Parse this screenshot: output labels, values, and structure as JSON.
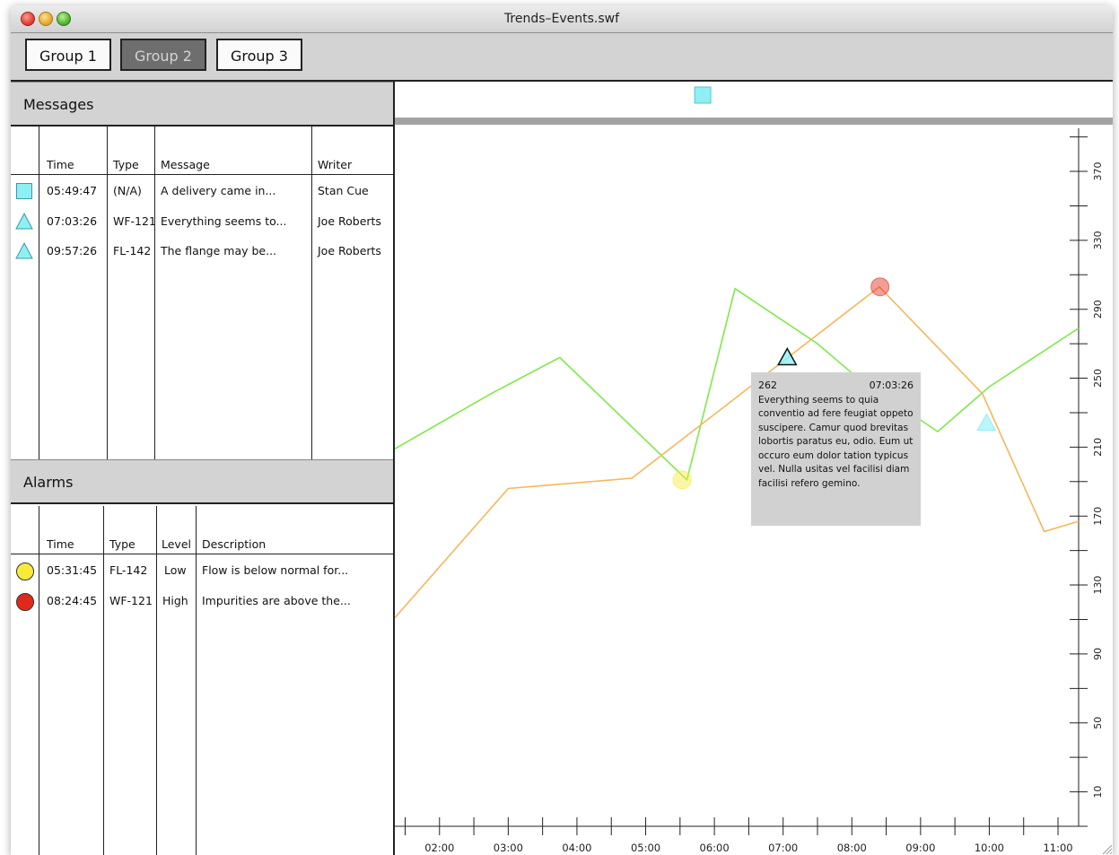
{
  "window": {
    "title": "Trends–Events.swf"
  },
  "toolbar": {
    "groups": [
      {
        "label": "Group 1",
        "active": false
      },
      {
        "label": "Group 2",
        "active": true
      },
      {
        "label": "Group 3",
        "active": false
      }
    ]
  },
  "messages": {
    "title": "Messages",
    "columns": [
      "Time",
      "Type",
      "Message",
      "Writer"
    ],
    "rows": [
      {
        "icon": "square-icon",
        "color": "#8ef0f4",
        "time": "05:49:47",
        "type": "(N/A)",
        "message": "A delivery came in...",
        "writer": "Stan Cue"
      },
      {
        "icon": "triangle-icon",
        "color": "#8ef0f4",
        "time": "07:03:26",
        "type": "WF-121",
        "message": "Everything seems to...",
        "writer": "Joe Roberts"
      },
      {
        "icon": "triangle-icon",
        "color": "#8ef0f4",
        "time": "09:57:26",
        "type": "FL-142",
        "message": "The flange may be...",
        "writer": "Joe Roberts"
      }
    ]
  },
  "alarms": {
    "title": "Alarms",
    "columns": [
      "Time",
      "Type",
      "Level",
      "Description"
    ],
    "rows": [
      {
        "icon": "circle-icon",
        "color": "#f7ea3a",
        "time": "05:31:45",
        "type": "FL-142",
        "level": "Low",
        "description": "Flow is below normal for..."
      },
      {
        "icon": "circle-icon",
        "color": "#e0291d",
        "time": "08:24:45",
        "type": "WF-121",
        "level": "High",
        "description": "Impurities are above the..."
      }
    ]
  },
  "tooltip": {
    "value": "262",
    "time": "07:03:26",
    "text": "Everything seems to quia conventio ad fere feugiat oppeto suscipere. Camur quod brevitas lobortis paratus eu, odio. Eum ut occuro eum dolor tation typicus vel. Nulla usitas vel facilisi diam facilisi refero gemino."
  },
  "colors": {
    "series_green": "#7fe84a",
    "series_orange": "#f5b65b",
    "event_cyan": "#8ef0f4",
    "alarm_yellow": "#f7ea3a",
    "alarm_red": "#e0291d"
  },
  "chart_data": {
    "type": "line",
    "x_ticks": [
      "02:00",
      "03:00",
      "04:00",
      "05:00",
      "06:00",
      "07:00",
      "08:00",
      "09:00",
      "10:00",
      "11:00"
    ],
    "y_ticks": [
      10,
      50,
      90,
      130,
      170,
      210,
      250,
      290,
      330,
      370
    ],
    "xlim": [
      1.35,
      11.3
    ],
    "ylim": [
      -10,
      395
    ],
    "series": [
      {
        "color": "#7fe84a",
        "points": [
          [
            1.35,
            209
          ],
          [
            2.75,
            241
          ],
          [
            3.75,
            262
          ],
          [
            5.6,
            191
          ],
          [
            6.3,
            302
          ],
          [
            7.5,
            270
          ],
          [
            8.0,
            253
          ],
          [
            9.25,
            219
          ],
          [
            10.0,
            245
          ],
          [
            11.3,
            279
          ]
        ]
      },
      {
        "color": "#f5b65b",
        "points": [
          [
            1.35,
            111
          ],
          [
            3.0,
            186
          ],
          [
            4.8,
            192
          ],
          [
            8.4,
            303
          ],
          [
            9.9,
            241
          ],
          [
            10.8,
            161
          ],
          [
            11.3,
            167
          ]
        ]
      }
    ],
    "alarm_markers": [
      {
        "time": 5.53,
        "value": 191,
        "color": "#f7ea3a",
        "shape": "circle"
      },
      {
        "time": 8.41,
        "value": 303,
        "color": "#e0291d",
        "shape": "circle"
      }
    ],
    "message_markers": [
      {
        "time": 7.06,
        "value": 262,
        "color": "#8ef0f4",
        "shape": "triangle",
        "selected": true
      },
      {
        "time": 9.96,
        "value": 224,
        "color": "#8ef0f4",
        "shape": "triangle",
        "selected": false
      }
    ],
    "top_strip_markers": [
      {
        "time": 5.83,
        "color": "#8ef0f4",
        "shape": "square"
      }
    ]
  }
}
